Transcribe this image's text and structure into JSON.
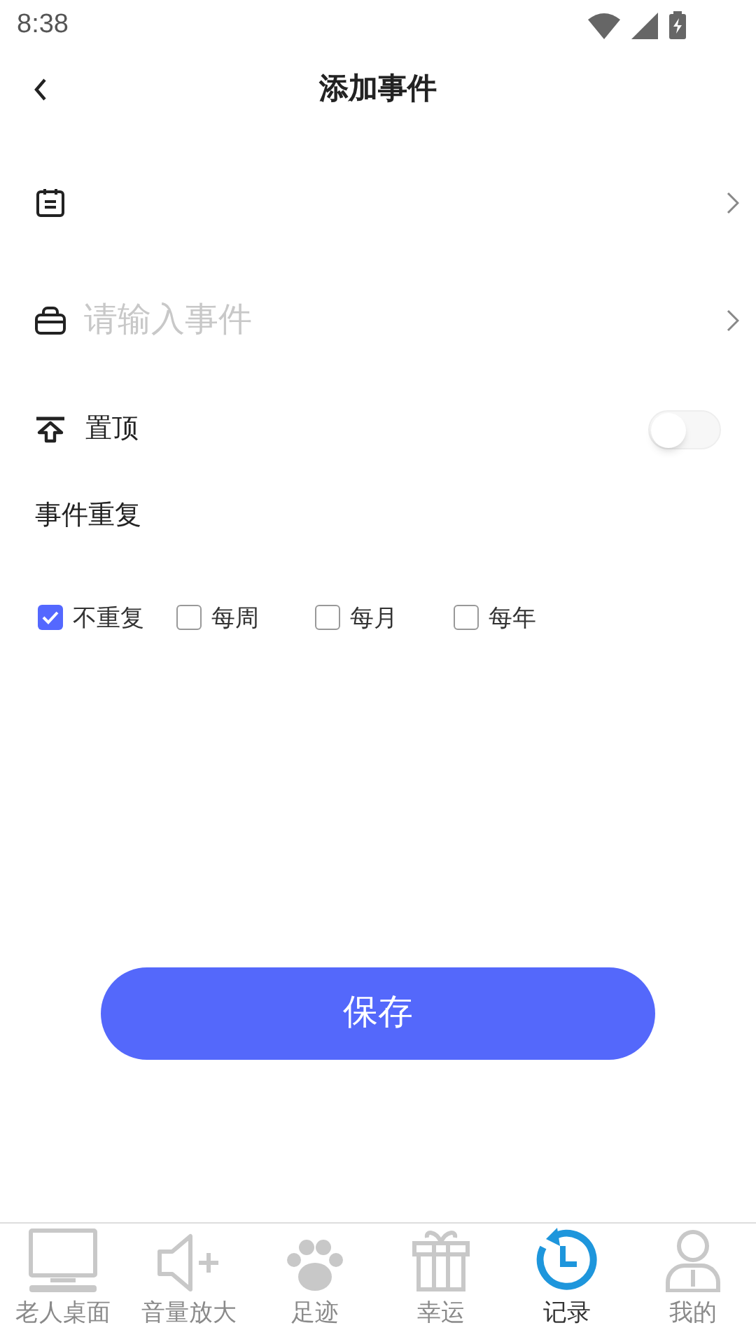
{
  "status_bar": {
    "time": "8:38"
  },
  "header": {
    "title": "添加事件"
  },
  "form": {
    "date_row": {
      "kind": "picker"
    },
    "event_field": {
      "placeholder": "请输入事件"
    },
    "pin_row": {
      "label": "置顶",
      "on": false
    },
    "repeat": {
      "label": "事件重复",
      "options": [
        {
          "label": "不重复",
          "checked": true
        },
        {
          "label": "每周",
          "checked": false
        },
        {
          "label": "每月",
          "checked": false
        },
        {
          "label": "每年",
          "checked": false
        }
      ]
    }
  },
  "save_button": {
    "label": "保存"
  },
  "tab_bar": [
    {
      "label": "老人桌面",
      "kind": "desktop",
      "selected": false
    },
    {
      "label": "音量放大",
      "kind": "speaker",
      "selected": false
    },
    {
      "label": "足迹",
      "kind": "paw",
      "selected": false
    },
    {
      "label": "幸运",
      "kind": "gift",
      "selected": false
    },
    {
      "label": "记录",
      "kind": "history",
      "selected": true
    },
    {
      "label": "我的",
      "kind": "person",
      "selected": false
    }
  ]
}
